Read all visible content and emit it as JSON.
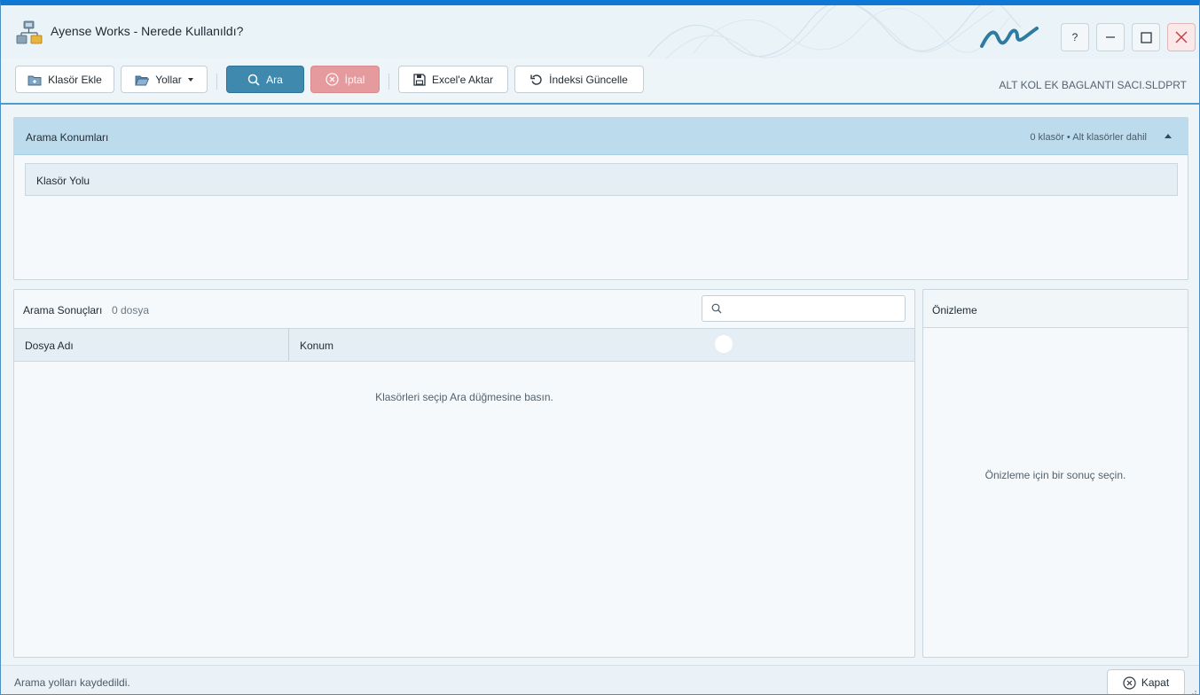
{
  "window": {
    "title": "Ayense Works - Nerede Kullanıldı?",
    "help_label": "?",
    "accent_color": "#0f78d4"
  },
  "toolbar": {
    "add_folder_label": "Klasör Ekle",
    "paths_label": "Yollar",
    "search_label": "Ara",
    "cancel_label": "İptal",
    "export_label": "Excel'e Aktar",
    "update_index_label": "İndeksi Güncelle",
    "current_file": "ALT KOL EK BAGLANTI SACI.SLDPRT"
  },
  "locations": {
    "title": "Arama Konumları",
    "summary": "0 klasör • Alt klasörler dahil",
    "column_header": "Klasör Yolu"
  },
  "results": {
    "title": "Arama Sonuçları",
    "count": "0 dosya",
    "search_placeholder": "",
    "columns": [
      "Dosya Adı",
      "Konum"
    ],
    "empty_message": "Klasörleri seçip Ara düğmesine basın."
  },
  "preview": {
    "title": "Önizleme",
    "empty_message": "Önizleme için bir sonuç seçin."
  },
  "status": {
    "text": "Arama yolları kaydedildi.",
    "close_label": "Kapat"
  },
  "icons": {
    "app": "network-folders-icon",
    "brand": "brand-logo-icon",
    "add_folder": "folder-plus-icon",
    "paths": "folder-open-icon",
    "search": "search-icon",
    "cancel": "cancel-circle-icon",
    "export": "save-disk-icon",
    "refresh": "refresh-icon",
    "close": "close-circle-icon"
  },
  "colors": {
    "primary_button": "#3f88ae",
    "cancel_button": "#e59a9d",
    "section_header": "#bcdcee"
  }
}
